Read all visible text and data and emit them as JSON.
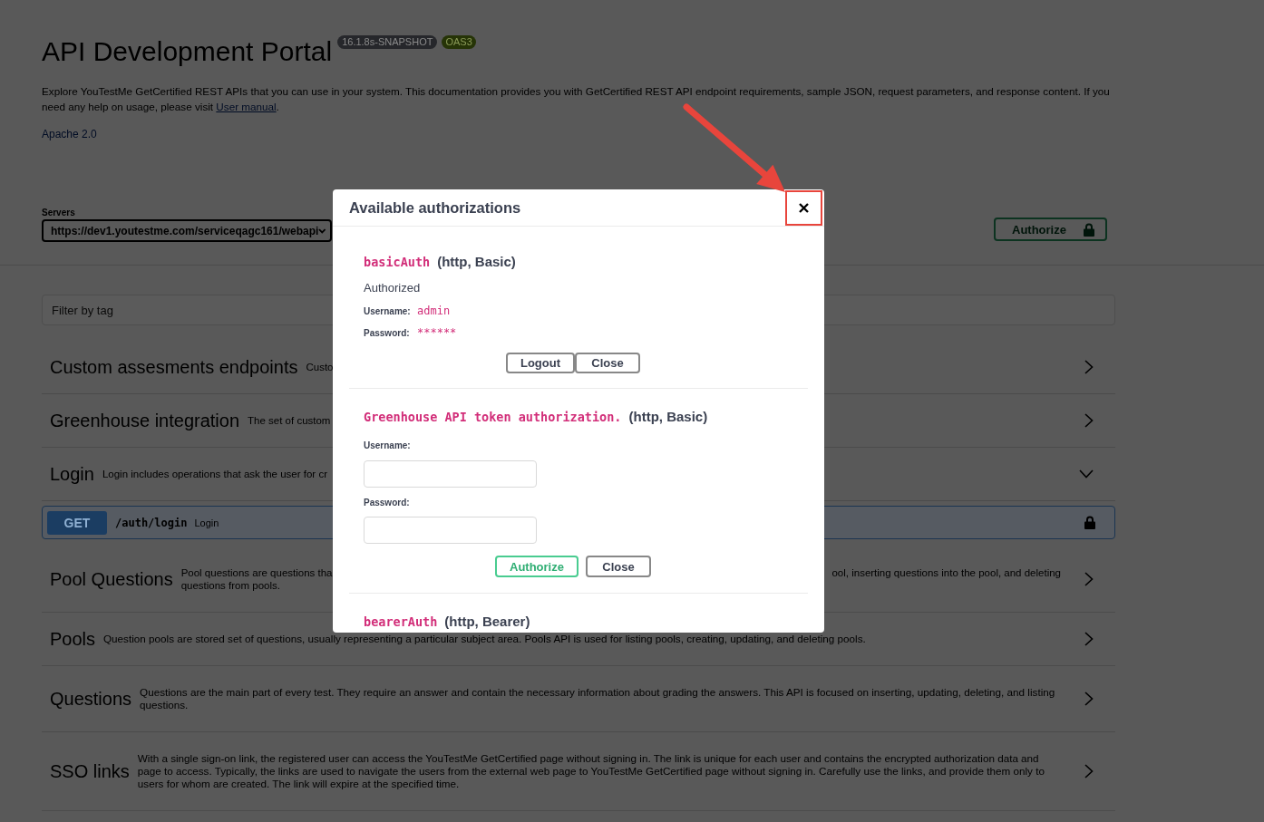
{
  "header": {
    "title": "API Development Portal",
    "badges": [
      {
        "label": "16.1.8s-SNAPSHOT",
        "kind": "version"
      },
      {
        "label": "OAS3",
        "kind": "spec"
      }
    ],
    "description": {
      "text": "Explore YouTestMe GetCertified REST APIs that you can use in your system. This documentation provides you with GetCertified REST API endpoint requirements, sample JSON, request parameters, and response content. If you need any help on usage, please visit ",
      "link": "User manual",
      "end": "."
    },
    "license": "Apache 2.0"
  },
  "servers": {
    "label": "Servers",
    "value": "https://dev1.youtestme.com/serviceqagc161/webapi"
  },
  "authorize_button": {
    "label": "Authorize"
  },
  "filter": {
    "placeholder": "Filter by tag"
  },
  "tags": [
    {
      "name": "Custom assesments endpoints",
      "description_left": [
        "Custo"
      ],
      "expanded": false
    },
    {
      "name": "Greenhouse integration",
      "description_left": [
        "The set of custom"
      ],
      "expanded": false
    },
    {
      "name": "Login",
      "description_left": [
        "Login includes operations that ask the user for cr"
      ],
      "expanded": true,
      "operations": [
        {
          "kind": "get",
          "method": "GET",
          "path": "/auth/login",
          "summary": "Login",
          "locked": true
        }
      ]
    },
    {
      "name": "Pool Questions",
      "description_left": [
        "Pool questions are questions tha",
        "questions from pools."
      ],
      "description_right": [
        "ool, inserting questions into the pool, and deleting"
      ],
      "expanded": false
    },
    {
      "name": "Pools",
      "description": "Question pools are stored set of questions, usually representing a particular subject area. Pools API is used for listing pools, creating, updating, and deleting pools.",
      "expanded": false
    },
    {
      "name": "Questions",
      "description": "Questions are the main part of every test. They require an answer and contain the necessary information about grading the answers. This API is focused on inserting, updating, deleting, and listing questions.",
      "expanded": false
    },
    {
      "name": "SSO links",
      "description": "With a single sign-on link, the registered user can access the YouTestMe GetCertified page without signing in. The link is unique for each user and contains the encrypted authorization data and page to access. Typically, the links are used to navigate the users from the external web page to YouTestMe GetCertified page without signing in. Carefully use the links, and provide them only to users for whom are created. The link will expire at the specified time.",
      "expanded": false
    }
  ],
  "modal": {
    "title": "Available authorizations",
    "schemes": [
      {
        "name": "basicAuth",
        "type": "(http, Basic)",
        "status": "Authorized",
        "fields": [
          {
            "kind": "value",
            "label": "Username:",
            "value": "admin"
          },
          {
            "kind": "value",
            "label": "Password:",
            "value": "******"
          }
        ],
        "buttons": [
          {
            "kind": "plain",
            "label": "Logout"
          },
          {
            "kind": "plain",
            "label": "Close"
          }
        ]
      },
      {
        "name": "Greenhouse API token authorization.",
        "type": "(http, Basic)",
        "fields": [
          {
            "kind": "input",
            "label": "Username:"
          },
          {
            "kind": "input",
            "label": "Password:"
          }
        ],
        "buttons": [
          {
            "kind": "authorize",
            "label": "Authorize"
          },
          {
            "kind": "plain",
            "label": "Close"
          }
        ]
      },
      {
        "name": "bearerAuth",
        "type": "(http, Bearer)"
      }
    ]
  }
}
